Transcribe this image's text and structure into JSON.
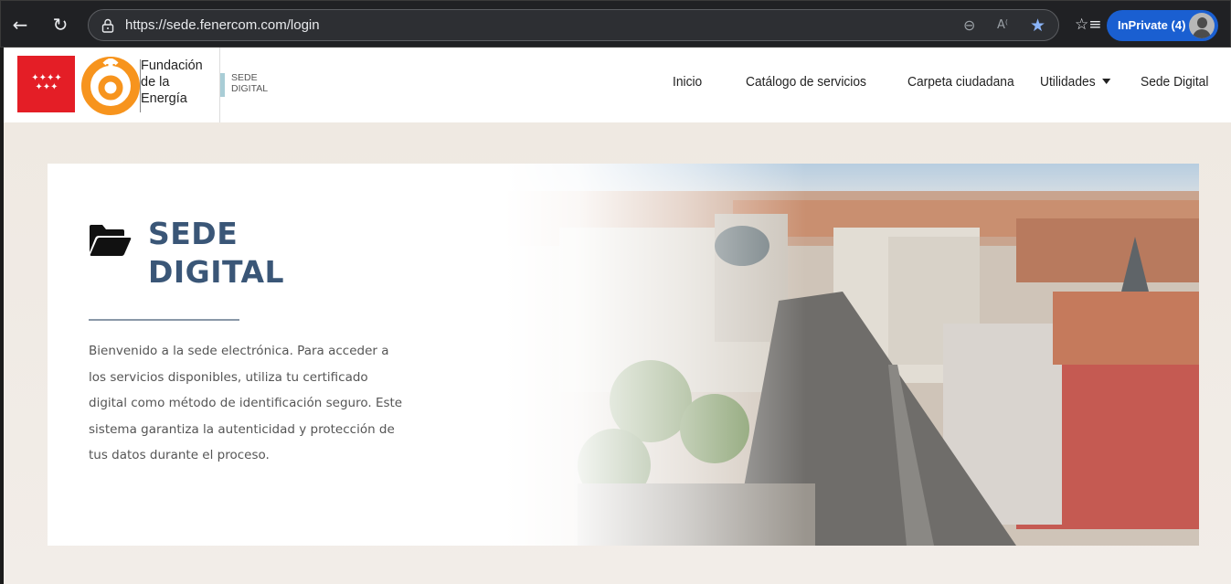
{
  "browser": {
    "url": "https://sede.fenercom.com/login",
    "inprivate_label": "InPrivate (4)",
    "icons": {
      "back": "back-arrow-icon",
      "reload": "reload-icon",
      "lock": "lock-icon",
      "zoom": "zoom-out-icon",
      "read_aloud": "read-aloud-icon",
      "favorite": "star-icon",
      "favorites": "favorites-list-icon",
      "profile": "avatar"
    },
    "accent_color": "#1a5fd1"
  },
  "header": {
    "logo": {
      "org_name_lines": [
        "Fundación",
        "de la",
        "Energía"
      ],
      "sede_lines": [
        "SEDE",
        "DIGITAL"
      ],
      "flag_color": "#e41e26",
      "logo_color": "#f7941d"
    },
    "nav": {
      "inicio": "Inicio",
      "catalogo": "Catálogo de servicios",
      "carpeta": "Carpeta ciudadana",
      "utilidades": "Utilidades",
      "sede": "Sede Digital"
    }
  },
  "hero": {
    "title_line1": "SEDE",
    "title_line2": "DIGITAL",
    "title_color": "#3a5677",
    "description": "Bienvenido a la sede electrónica. Para acceder a los servicios disponibles, utiliza tu certificado digital como método de identificación seguro. Este sistema garantiza la autenticidad y protección de tus datos durante el proceso.",
    "image_alt": "city-aerial-image"
  }
}
